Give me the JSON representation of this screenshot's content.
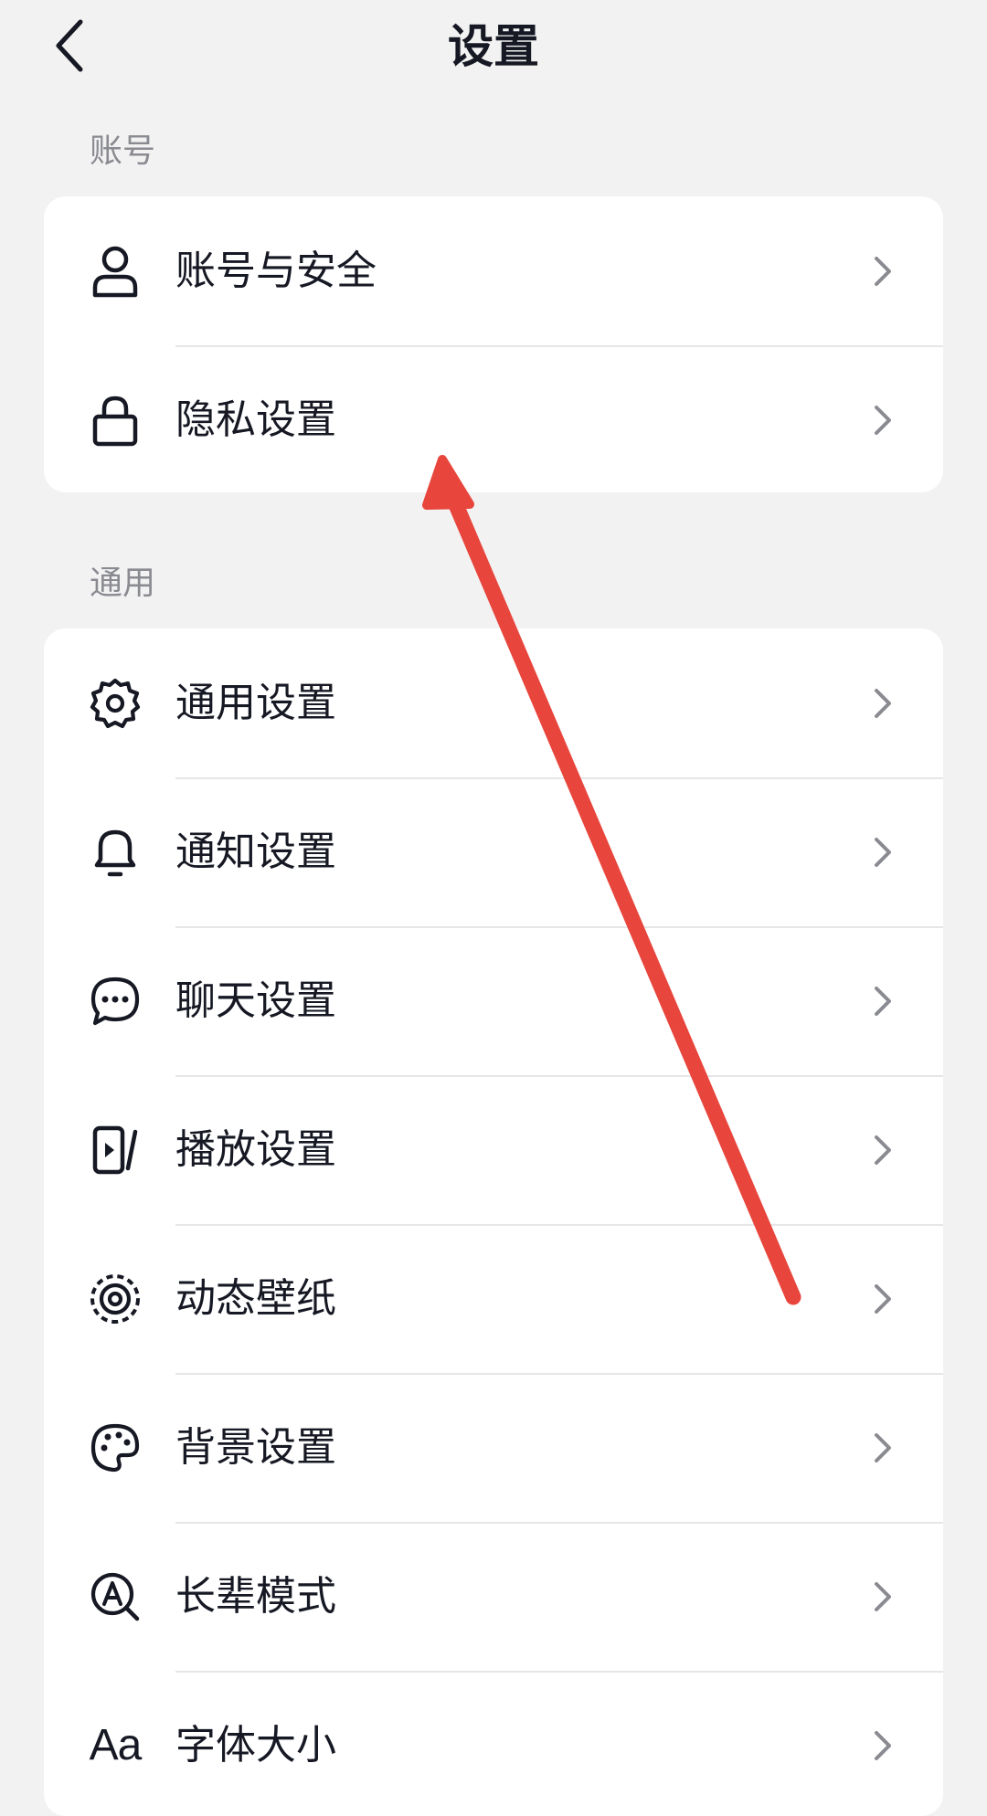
{
  "header": {
    "title": "设置",
    "back_icon": "chevron-left-icon"
  },
  "sections": [
    {
      "label": "账号",
      "items": [
        {
          "label": "账号与安全",
          "icon": "user-icon"
        },
        {
          "label": "隐私设置",
          "icon": "lock-icon"
        }
      ]
    },
    {
      "label": "通用",
      "items": [
        {
          "label": "通用设置",
          "icon": "gear-icon"
        },
        {
          "label": "通知设置",
          "icon": "bell-icon"
        },
        {
          "label": "聊天设置",
          "icon": "chat-bubble-icon"
        },
        {
          "label": "播放设置",
          "icon": "play-screen-icon"
        },
        {
          "label": "动态壁纸",
          "icon": "live-wallpaper-icon"
        },
        {
          "label": "背景设置",
          "icon": "palette-icon"
        },
        {
          "label": "长辈模式",
          "icon": "elder-mode-icon"
        },
        {
          "label": "字体大小",
          "icon": "font-size-icon",
          "glyph": "Aa"
        }
      ]
    }
  ],
  "colors": {
    "background": "#f2f2f2",
    "card": "#ffffff",
    "text": "#161823",
    "section_label": "#8a8b91",
    "chevron": "#8a8b91",
    "annotation_arrow": "#e8453c"
  }
}
